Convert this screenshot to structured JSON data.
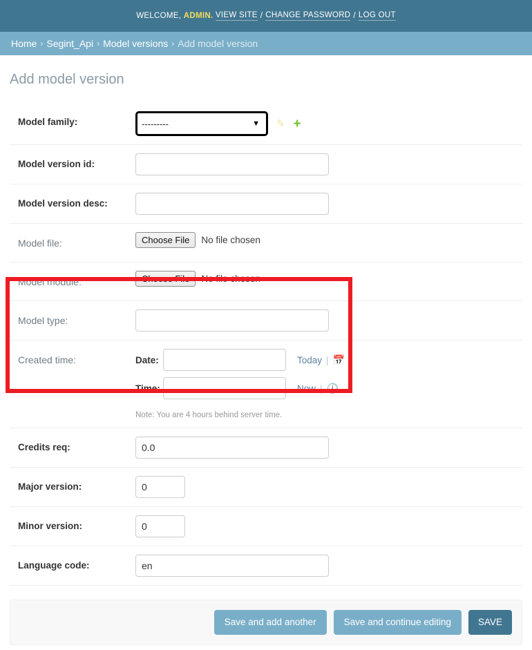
{
  "user_tools": {
    "welcome": "WELCOME,",
    "username": "ADMIN.",
    "view_site": "VIEW SITE",
    "change_password": "CHANGE PASSWORD",
    "log_out": "LOG OUT",
    "separator": "/"
  },
  "breadcrumbs": {
    "separator": "›",
    "items": [
      {
        "label": "Home",
        "current": false
      },
      {
        "label": "Segint_Api",
        "current": false
      },
      {
        "label": "Model versions",
        "current": false
      },
      {
        "label": "Add model version",
        "current": true
      }
    ]
  },
  "page": {
    "title": "Add model version"
  },
  "form": {
    "model_family": {
      "label": "Model family:",
      "selected": "---------",
      "options": [
        "---------"
      ],
      "edit_icon": "pencil-icon",
      "add_icon": "plus-icon"
    },
    "model_version_id": {
      "label": "Model version id:",
      "value": ""
    },
    "model_version_desc": {
      "label": "Model version desc:",
      "value": ""
    },
    "model_file": {
      "label": "Model file:",
      "button": "Choose File",
      "status": "No file chosen"
    },
    "model_module": {
      "label": "Model module:",
      "button": "Choose File",
      "status": "No file chosen"
    },
    "model_type": {
      "label": "Model type:",
      "value": ""
    },
    "created_time": {
      "label": "Created time:",
      "date_label": "Date:",
      "date_value": "",
      "today_link": "Today",
      "time_label": "Time:",
      "time_value": "",
      "now_link": "Now",
      "pipe": "|",
      "note": "Note: You are 4 hours behind server time.",
      "calendar_icon": "calendar-icon",
      "clock_icon": "clock-icon"
    },
    "credits_req": {
      "label": "Credits req:",
      "value": "0.0"
    },
    "major_version": {
      "label": "Major version:",
      "value": "0"
    },
    "minor_version": {
      "label": "Minor version:",
      "value": "0"
    },
    "language_code": {
      "label": "Language code:",
      "value": "en"
    }
  },
  "submit_row": {
    "save_and_add_another": "Save and add another",
    "save_and_continue": "Save and continue editing",
    "save": "SAVE"
  },
  "colors": {
    "header_bar": "#417690",
    "breadcrumb_bar": "#79aec8",
    "highlight_border": "#ee1c24",
    "accent_yellow": "#f5dd5d",
    "button_light": "#79aec8",
    "button_dark": "#417690",
    "add_icon_green": "#70bf2b"
  }
}
